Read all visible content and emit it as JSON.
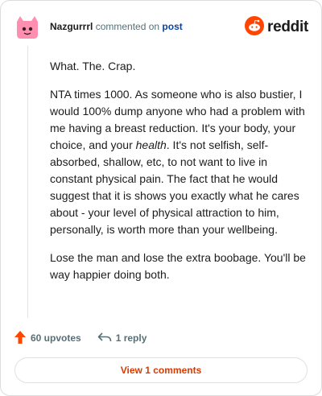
{
  "header": {
    "username": "Nazgurrrl",
    "action_text": "commented on",
    "post_link": "post",
    "brand_word": "reddit"
  },
  "comment": {
    "paragraphs": [
      "What. The. Crap.",
      "NTA times 1000. As someone who is also bustier, I would 100% dump anyone who had a problem with me having a breast reduction. It's your body, your choice, and your health. It's not selfish, self-absorbed, shallow, etc, to not want to live in constant physical pain. The fact that he would suggest that it is shows you exactly what he cares about - your level of physical attraction to him, personally, is worth more than your wellbeing.",
      "Lose the man and lose the extra boobage. You'll be way happier doing both."
    ],
    "p2_before": "NTA times 1000. As someone who is also bustier, I would 100% dump anyone who had a problem with me having a breast reduction. It's your body, your choice, and your ",
    "p2_emphasis": "health",
    "p2_after": ". It's not selfish, self-absorbed, shallow, etc, to not want to live in constant physical pain. The fact that he would suggest that it is shows you exactly what he cares about - your level of physical attraction to him, personally, is worth more than your wellbeing."
  },
  "actions": {
    "upvotes": "60 upvotes",
    "replies": "1 reply"
  },
  "footer": {
    "view_comments": "View 1 comments"
  },
  "colors": {
    "accent": "#d93a00",
    "upvote": "#ff4500",
    "avatar": "#ff8fb1",
    "link": "#0a449b"
  },
  "icons": {
    "avatar": "pink-snoo-avatar-icon",
    "brand": "reddit-logo-icon",
    "upvote": "upvote-arrow-icon",
    "reply": "reply-arrow-icon"
  }
}
